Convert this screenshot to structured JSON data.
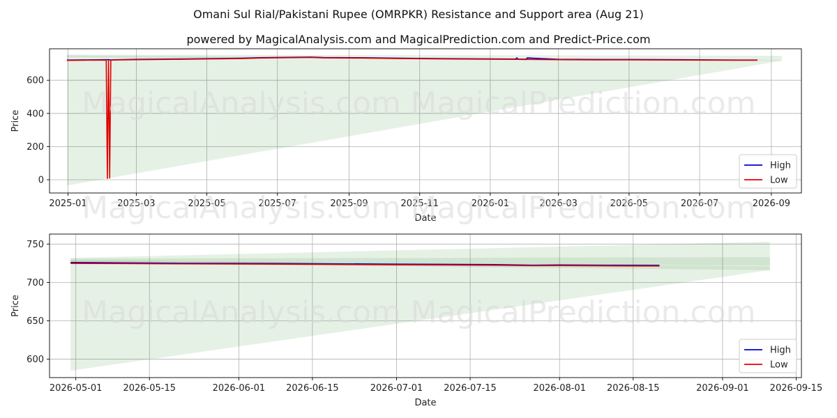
{
  "title": "Omani Sul Rial/Pakistani Rupee (OMRPKR) Resistance and Support area (Aug 21)",
  "subtitle": "powered by MagicalAnalysis.com and MagicalPrediction.com and Predict-Price.com",
  "watermarks": [
    "MagicalAnalysis.com",
    "MagicalPrediction.com"
  ],
  "colors": {
    "high": "#0000cc",
    "low": "#e00000",
    "band": "#2e8b2e",
    "grid": "#b0b0b0"
  },
  "chart_data": [
    {
      "type": "line",
      "xlabel": "Date",
      "ylabel": "Price",
      "xlim": [
        "2024-12-16",
        "2026-09-27"
      ],
      "ylim": [
        -80,
        790
      ],
      "grid": true,
      "legend_position": "lower-right",
      "x_ticks": [
        "2025-01",
        "2025-03",
        "2025-05",
        "2025-07",
        "2025-09",
        "2025-11",
        "2026-01",
        "2026-03",
        "2026-05",
        "2026-07",
        "2026-09"
      ],
      "y_ticks": [
        0,
        200,
        400,
        600
      ],
      "series": [
        {
          "name": "High",
          "x": [
            "2024-12-31",
            "2025-01-15",
            "2025-02-03",
            "2025-02-04",
            "2025-02-05",
            "2025-02-06",
            "2025-02-07",
            "2025-03-01",
            "2025-04-15",
            "2025-06-01",
            "2025-06-15",
            "2025-07-30",
            "2025-08-10",
            "2025-09-12",
            "2025-10-15",
            "2025-12-01",
            "2026-01-23",
            "2026-01-24",
            "2026-01-25",
            "2026-02-01",
            "2026-02-02",
            "2026-03-01",
            "2026-04-01",
            "2026-05-01",
            "2026-06-15",
            "2026-08-01",
            "2026-08-20"
          ],
          "values": [
            722,
            723,
            724,
            724,
            724,
            723,
            723,
            726,
            729,
            733,
            736,
            740,
            737,
            736,
            733,
            730,
            728,
            735,
            728,
            727,
            735,
            726,
            725,
            725,
            724,
            722,
            722
          ]
        },
        {
          "name": "Low",
          "x": [
            "2024-12-31",
            "2025-01-15",
            "2025-02-03",
            "2025-02-04",
            "2025-02-05",
            "2025-02-06",
            "2025-02-07",
            "2025-03-01",
            "2025-04-15",
            "2025-06-01",
            "2025-06-15",
            "2025-07-30",
            "2025-08-10",
            "2025-09-12",
            "2025-10-15",
            "2025-12-01",
            "2026-01-23",
            "2026-01-24",
            "2026-01-25",
            "2026-02-01",
            "2026-02-02",
            "2026-03-01",
            "2026-04-01",
            "2026-05-01",
            "2026-06-15",
            "2026-08-01",
            "2026-08-20"
          ],
          "values": [
            720,
            721,
            722,
            8,
            720,
            10,
            722,
            724,
            727,
            731,
            734,
            738,
            735,
            734,
            731,
            728,
            726,
            727,
            726,
            725,
            726,
            724,
            723,
            723,
            722,
            721,
            721
          ]
        }
      ],
      "bands": [
        {
          "x": [
            "2024-12-31",
            "2026-09-10"
          ],
          "upper": [
            755,
            748
          ],
          "lower": [
            -35,
            718
          ]
        },
        {
          "x": [
            "2024-12-31",
            "2026-09-10"
          ],
          "upper": [
            750,
            722
          ],
          "lower": [
            738,
            718
          ]
        }
      ]
    },
    {
      "type": "line",
      "xlabel": "Date",
      "ylabel": "Price",
      "xlim": [
        "2026-04-26",
        "2026-09-16"
      ],
      "ylim": [
        576,
        763
      ],
      "grid": true,
      "legend_position": "lower-right",
      "x_ticks": [
        "2026-05-01",
        "2026-05-15",
        "2026-06-01",
        "2026-06-15",
        "2026-07-01",
        "2026-07-15",
        "2026-08-01",
        "2026-08-15",
        "2026-09-01",
        "2026-09-15"
      ],
      "y_ticks": [
        600,
        650,
        700,
        750
      ],
      "series": [
        {
          "name": "High",
          "x": [
            "2026-04-30",
            "2026-05-10",
            "2026-05-20",
            "2026-06-01",
            "2026-06-10",
            "2026-06-20",
            "2026-07-01",
            "2026-07-10",
            "2026-07-20",
            "2026-07-27",
            "2026-08-01",
            "2026-08-10",
            "2026-08-20"
          ],
          "values": [
            726,
            725.5,
            725,
            724.8,
            724.6,
            724.2,
            723.8,
            723.6,
            723.2,
            722.4,
            722.8,
            722.5,
            722.3
          ]
        },
        {
          "name": "Low",
          "x": [
            "2026-04-30",
            "2026-05-10",
            "2026-05-20",
            "2026-06-01",
            "2026-06-10",
            "2026-06-20",
            "2026-07-01",
            "2026-07-10",
            "2026-07-20",
            "2026-07-27",
            "2026-08-01",
            "2026-08-10",
            "2026-08-20"
          ],
          "values": [
            724.8,
            724.6,
            724.2,
            724,
            723.8,
            723.4,
            723,
            722.8,
            722.4,
            721.8,
            722,
            721.6,
            721.4
          ]
        }
      ],
      "bands": [
        {
          "x": [
            "2026-04-30",
            "2026-09-10"
          ],
          "upper": [
            732,
            753
          ],
          "lower": [
            585,
            716
          ]
        },
        {
          "x": [
            "2026-04-30",
            "2026-09-10"
          ],
          "upper": [
            731,
            733
          ],
          "lower": [
            727,
            722
          ]
        },
        {
          "x": [
            "2026-04-30",
            "2026-09-10"
          ],
          "upper": [
            729,
            721
          ],
          "lower": [
            725,
            716
          ]
        }
      ]
    }
  ]
}
